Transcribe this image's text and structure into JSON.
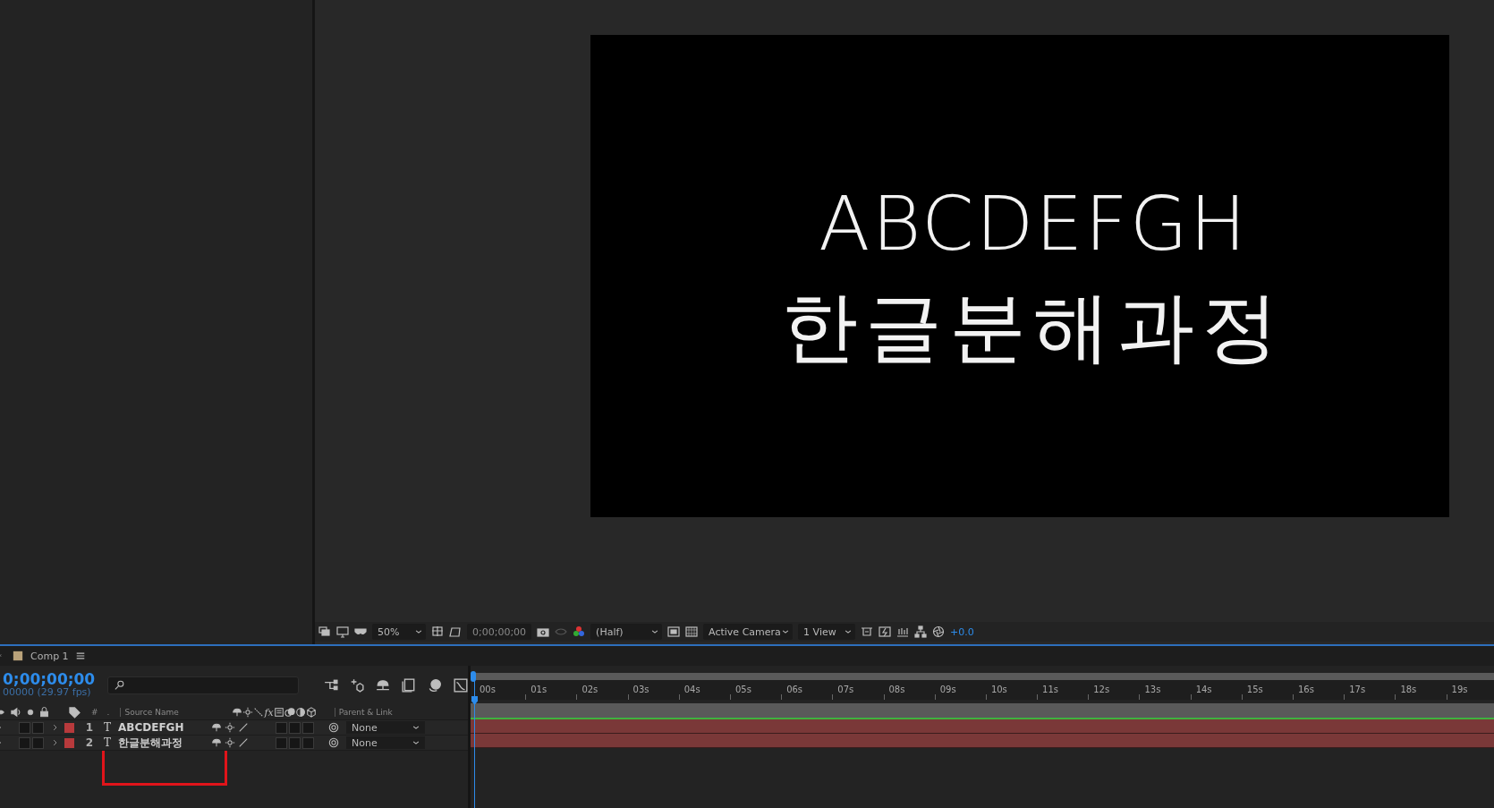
{
  "viewer": {
    "comp_lines": [
      "ABCDEFGH",
      "한글분해과정"
    ],
    "toolbar": {
      "zoom": "50%",
      "timecode": "0;00;00;00",
      "resolution": "(Half)",
      "camera": "Active Camera",
      "views": "1 View",
      "exposure": "+0.0"
    }
  },
  "timeline": {
    "tab": "Comp 1",
    "timecode": "0;00;00;00",
    "frame_info": "00000 (29.97 fps)",
    "columns": {
      "number": "#",
      "dot": ".",
      "source_name": "Source Name",
      "fx": "fx",
      "parent": "Parent & Link"
    },
    "source_name_highlighted": true,
    "layers": [
      {
        "number": "1",
        "type_glyph": "T",
        "name": "ABCDEFGH",
        "parent": "None",
        "color": "#b83a3c"
      },
      {
        "number": "2",
        "type_glyph": "T",
        "name": "한글분해과정",
        "parent": "None",
        "color": "#b83a3c"
      }
    ],
    "ruler": [
      "00s",
      "01s",
      "02s",
      "03s",
      "04s",
      "05s",
      "06s",
      "07s",
      "08s",
      "09s",
      "10s",
      "11s",
      "12s",
      "13s",
      "14s",
      "15s",
      "16s",
      "17s",
      "18s",
      "19s"
    ]
  }
}
